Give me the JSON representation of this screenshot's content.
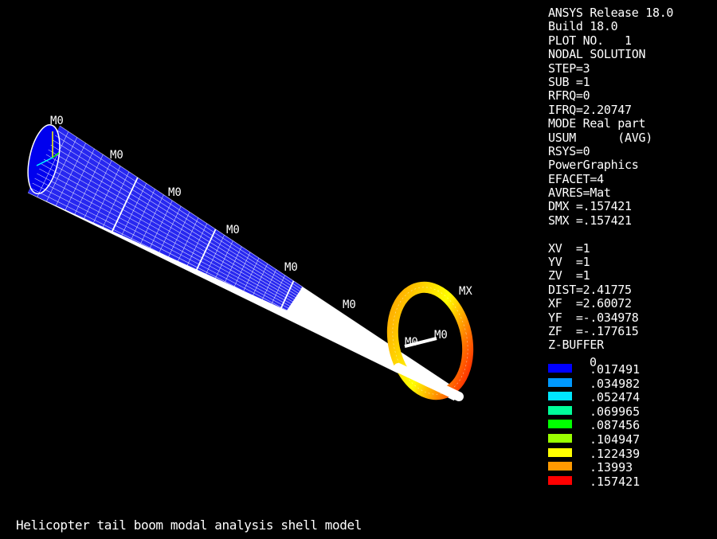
{
  "info_lines": [
    "ANSYS Release 18.0",
    "Build 18.0",
    "PLOT NO.   1",
    "NODAL SOLUTION",
    "STEP=3",
    "SUB =1",
    "RFRQ=0",
    "IFRQ=2.20747",
    "MODE Real part",
    "USUM      (AVG)",
    "RSYS=0",
    "PowerGraphics",
    "EFACET=4",
    "AVRES=Mat",
    "DMX =.157421",
    "SMX =.157421",
    "",
    "XV  =1",
    "YV  =1",
    "ZV  =1",
    "DIST=2.41775",
    "XF  =2.60072",
    "YF  =-.034978",
    "ZF  =-.177615",
    "Z-BUFFER"
  ],
  "legend": {
    "zero_label": "0",
    "entries": [
      {
        "value": ".017491",
        "color": "#0000ff"
      },
      {
        "value": ".034982",
        "color": "#0099ff"
      },
      {
        "value": ".052474",
        "color": "#00e5ff"
      },
      {
        "value": ".069965",
        "color": "#00ff99"
      },
      {
        "value": ".087456",
        "color": "#00ff00"
      },
      {
        "value": ".104947",
        "color": "#99ff00"
      },
      {
        "value": ".122439",
        "color": "#ffff00"
      },
      {
        "value": ".13993",
        "color": "#ff9900"
      },
      {
        "value": ".157421",
        "color": "#ff0000"
      }
    ]
  },
  "markers": {
    "min_label": "M0",
    "max_label": "MX"
  },
  "caption": "Helicopter tail boom modal analysis shell model"
}
